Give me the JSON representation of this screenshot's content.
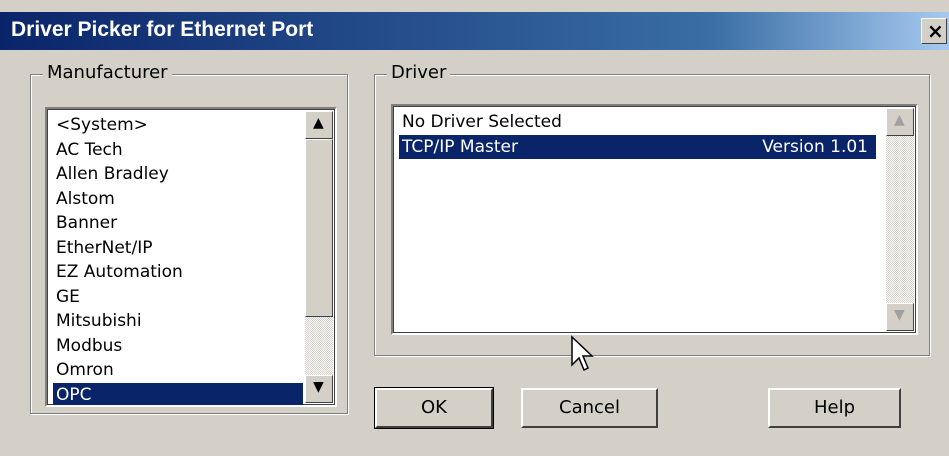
{
  "window": {
    "title": "Driver Picker for Ethernet Port",
    "close_label": "×"
  },
  "manufacturer": {
    "group_label": "Manufacturer",
    "items": [
      "<System>",
      "AC Tech",
      "Allen Bradley",
      "Alstom",
      "Banner",
      "EtherNet/IP",
      "EZ Automation",
      "GE",
      "Mitsubishi",
      "Modbus",
      "Omron",
      "OPC"
    ],
    "selected": "OPC"
  },
  "driver": {
    "group_label": "Driver",
    "items": [
      {
        "name": "No Driver Selected",
        "version": ""
      },
      {
        "name": "TCP/IP Master",
        "version": "Version 1.01"
      }
    ],
    "selected": "TCP/IP Master"
  },
  "buttons": {
    "ok": "OK",
    "cancel": "Cancel",
    "help": "Help"
  },
  "colors": {
    "titlebar_start": "#0a246a",
    "titlebar_end": "#a6caf0",
    "selection": "#0a246a",
    "face": "#d4d0c8"
  }
}
